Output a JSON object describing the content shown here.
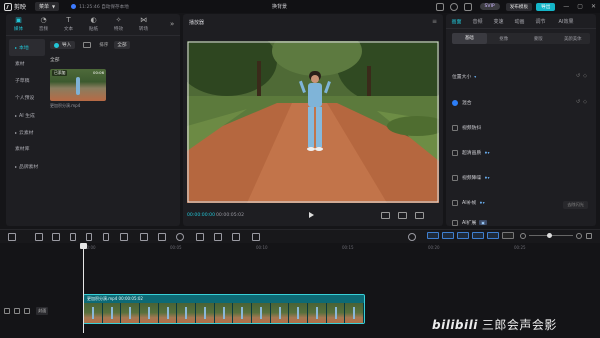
{
  "app": {
    "name": "剪映",
    "menu_label": "菜单",
    "draft_status": "11:25:46 自动保存本地",
    "window_title": "换背景",
    "svip_label": "SVIP",
    "publish_label": "发布模板",
    "export_label": "导出",
    "accent_color": "#22c5d6"
  },
  "toolbar": {
    "tools": [
      {
        "label": "媒体",
        "icon": "media-icon"
      },
      {
        "label": "音频",
        "icon": "audio-icon"
      },
      {
        "label": "文本",
        "icon": "text-icon"
      },
      {
        "label": "贴纸",
        "icon": "sticker-icon"
      },
      {
        "label": "特效",
        "icon": "effects-icon"
      },
      {
        "label": "转场",
        "icon": "transition-icon"
      }
    ]
  },
  "sidebar": {
    "items": [
      {
        "label": "本地",
        "arrow": "▸"
      },
      {
        "label": "素材",
        "arrow": ""
      },
      {
        "label": "子草稿",
        "arrow": ""
      },
      {
        "label": "个人预设",
        "arrow": ""
      },
      {
        "label": "AI 生成",
        "arrow": "▸"
      },
      {
        "label": "云素材",
        "arrow": "▸"
      },
      {
        "label": "素材库",
        "arrow": ""
      },
      {
        "label": "品牌素材",
        "arrow": "▸"
      }
    ]
  },
  "media": {
    "import_label": "导入",
    "sort_label": "排序",
    "filter_label": "全部",
    "group_label": "全部",
    "clip": {
      "badge": "已添加",
      "duration": "00:06",
      "name": "更加积分演.mp4"
    }
  },
  "player": {
    "title": "播放器",
    "current_time": "00:00:00:00",
    "total_time": "00:00:05:02"
  },
  "inspector": {
    "tabs": [
      "画面",
      "音频",
      "变速",
      "动画",
      "调节",
      "AI效果"
    ],
    "subtabs": [
      "基础",
      "抠像",
      "蒙版",
      "美颜美体"
    ],
    "properties": [
      {
        "label": "位置大小",
        "checkbox": false
      },
      {
        "label": "混合",
        "checkbox": true
      },
      {
        "label": "视频防抖",
        "checkbox": false
      },
      {
        "label": "超清画质",
        "checkbox": false
      },
      {
        "label": "视频降噪",
        "checkbox": false
      },
      {
        "label": "AI补帧",
        "checkbox": false
      },
      {
        "label": "AI扩展",
        "checkbox": false
      }
    ],
    "keyframe_button": "去除闪光"
  },
  "timeline": {
    "ruler_labels": [
      "00:00",
      "00:05",
      "00:10",
      "00:15",
      "00:20",
      "00:25"
    ],
    "clip_label": "更加积分演.mp4  00:00:05:02",
    "cover_label": "封面"
  },
  "watermark": {
    "brand": "bilibili",
    "text": "三郎会声会影"
  }
}
